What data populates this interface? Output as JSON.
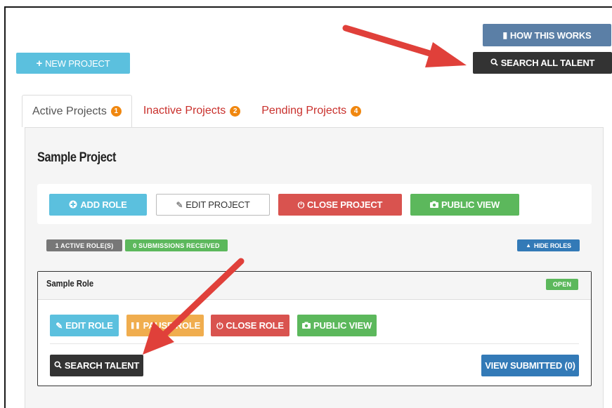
{
  "header": {
    "how_label": "HOW THIS WORKS",
    "search_all_label": "SEARCH ALL TALENT",
    "new_project_label": "NEW PROJECT"
  },
  "tabs": [
    {
      "label": "Active Projects",
      "count": "1"
    },
    {
      "label": "Inactive Projects",
      "count": "2"
    },
    {
      "label": "Pending Projects",
      "count": "4"
    }
  ],
  "project": {
    "title": "Sample Project",
    "add_role_label": "ADD ROLE",
    "edit_project_label": "EDIT PROJECT",
    "close_project_label": "CLOSE PROJECT",
    "public_view_label": "PUBLIC VIEW",
    "active_roles_label": "1 ACTIVE ROLE(S)",
    "submissions_label": "0 SUBMISSIONS RECEIVED",
    "hide_roles_label": "HIDE ROLES"
  },
  "role": {
    "title": "Sample Role",
    "status": "OPEN",
    "edit_role_label": "EDIT ROLE",
    "pause_role_label": "PAUSE ROLE",
    "close_role_label": "CLOSE ROLE",
    "public_view_label": "PUBLIC VIEW",
    "search_talent_label": "SEARCH TALENT",
    "view_submitted_label": "VIEW SUBMITTED (0)"
  },
  "colors": {
    "annotation_arrow": "#e0403a",
    "info": "#5bc0de",
    "danger": "#d9534f",
    "success": "#5cb85c",
    "primary": "#337ab7",
    "warning": "#f0ad4e",
    "badge": "#f0870f",
    "dark": "#333333"
  }
}
